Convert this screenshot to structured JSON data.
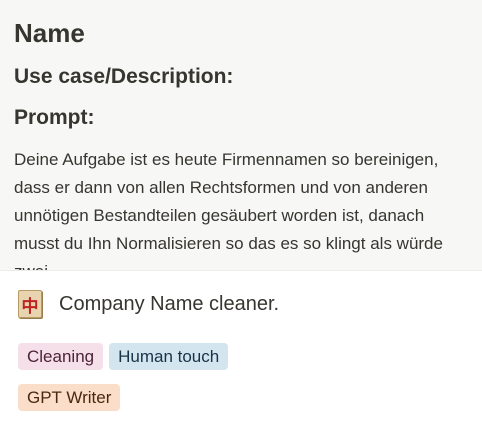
{
  "preview": {
    "heading_name": "Name",
    "heading_usecase": "Use case/Description:",
    "heading_prompt": "Prompt:",
    "prompt_text": "Deine Aufgabe ist es heute Firmennamen so bereinigen, dass er dann  von allen Rechtsformen und von anderen unnötigen Bestandteilen gesäubert worden ist, danach musst du Ihn Normalisieren so das es so klingt als würde zwei"
  },
  "card": {
    "icon_glyph": "中",
    "icon_name": "mahjong-red-dragon-icon",
    "title": "Company Name cleaner."
  },
  "tags": [
    {
      "label": "Cleaning",
      "color": "#f5e0e9"
    },
    {
      "label": "Human touch",
      "color": "#d3e5ef"
    },
    {
      "label": "GPT Writer",
      "color": "#fadec9"
    }
  ]
}
